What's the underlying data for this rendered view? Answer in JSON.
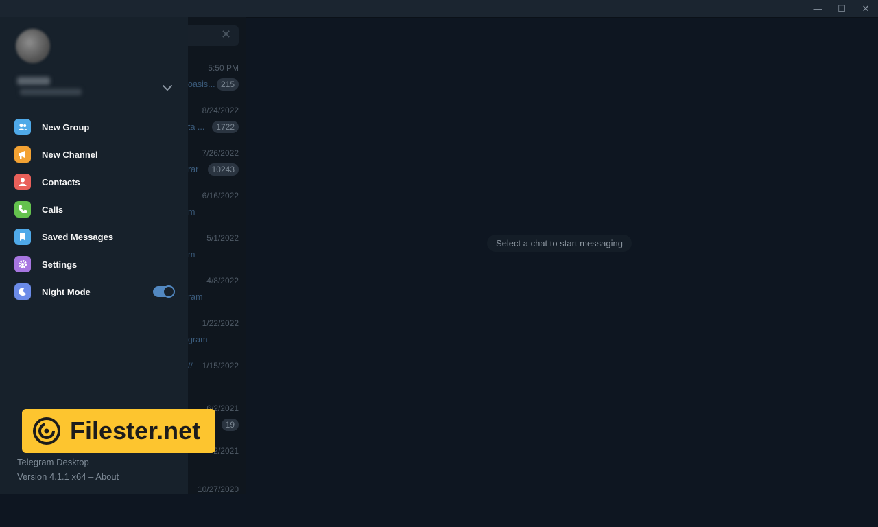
{
  "titlebar": {
    "minimize": "—",
    "maximize": "☐",
    "close": "✕"
  },
  "chat_list": {
    "rows": [
      {
        "time": "5:50 PM",
        "snippet": "oasis...",
        "badge": "215"
      },
      {
        "time": "8/24/2022",
        "snippet": "ta ...",
        "badge": "1722"
      },
      {
        "time": "7/26/2022",
        "snippet": "rar",
        "badge": "10243"
      },
      {
        "time": "6/16/2022",
        "snippet": "m",
        "badge": ""
      },
      {
        "time": "5/1/2022",
        "snippet": "m",
        "badge": ""
      },
      {
        "time": "4/8/2022",
        "snippet": "ram",
        "badge": ""
      },
      {
        "time": "1/22/2022",
        "snippet": "gram",
        "badge": ""
      },
      {
        "time": "1/15/2022",
        "snippet": "",
        "badge": ""
      },
      {
        "time": "6/2/2021",
        "snippet": "",
        "badge": "19"
      },
      {
        "time": "2/2021",
        "snippet": "",
        "badge": ""
      },
      {
        "time": "10/27/2020",
        "snippet": "",
        "badge": ""
      }
    ]
  },
  "main": {
    "empty_text": "Select a chat to start messaging"
  },
  "menu": {
    "items": [
      {
        "label": "New Group",
        "icon": "group-icon",
        "color": "#4fa9e8"
      },
      {
        "label": "New Channel",
        "icon": "megaphone-icon",
        "color": "#f3a233"
      },
      {
        "label": "Contacts",
        "icon": "person-icon",
        "color": "#e9605a"
      },
      {
        "label": "Calls",
        "icon": "phone-icon",
        "color": "#64c24e"
      },
      {
        "label": "Saved Messages",
        "icon": "bookmark-icon",
        "color": "#4fa9e8"
      },
      {
        "label": "Settings",
        "icon": "gear-icon",
        "color": "#a776e0"
      },
      {
        "label": "Night Mode",
        "icon": "moon-icon",
        "color": "#6b8be8"
      }
    ],
    "night_mode_on": true
  },
  "footer": {
    "app_name": "Telegram Desktop",
    "version": "Version 4.1.1 x64 – About"
  },
  "watermark": {
    "text": "Filester.net"
  },
  "colors": {
    "accent": "#5288c1",
    "drawer_bg": "#17212b",
    "window_bg": "#0e1621"
  }
}
